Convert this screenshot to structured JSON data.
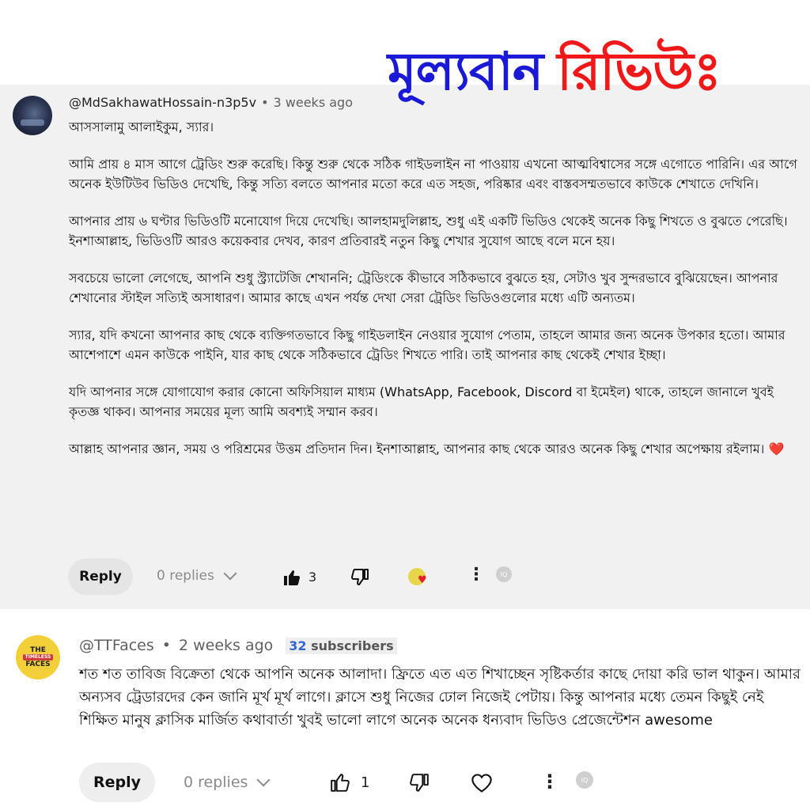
{
  "banner": {
    "word1": "মূল্যবান",
    "word2": "রিভিউঃ"
  },
  "comment1": {
    "author": "@MdSakhawatHossain-n3p5v",
    "time": "3 weeks ago",
    "paragraphs": [
      "আসসালামু আলাইকুম, স্যার।",
      "আমি প্রায় ৪ মাস আগে ট্রেডিং শুরু করেছি। কিন্তু শুরু থেকে সঠিক গাইডলাইন না পাওয়ায় এখনো আত্মবিশ্বাসের সঙ্গে এগোতে পারিনি। এর আগে অনেক ইউটিউব ভিডিও দেখেছি, কিন্তু সত্যি বলতে আপনার মতো করে এত সহজ, পরিষ্কার এবং বাস্তবসম্মতভাবে কাউকে শেখাতে দেখিনি।",
      "আপনার প্রায় ৬ ঘণ্টার ভিডিওটি মনোযোগ দিয়ে দেখেছি। আলহামদুলিল্লাহ, শুধু এই একটি ভিডিও থেকেই অনেক কিছু শিখতে ও বুঝতে পেরেছি। ইনশাআল্লাহ, ভিডিওটি আরও কয়েকবার দেখব, কারণ প্রতিবারই নতুন কিছু শেখার সুযোগ আছে বলে মনে হয়।",
      "সবচেয়ে ভালো লেগেছে, আপনি শুধু স্ট্র্যাটেজি শেখাননি; ট্রেডিংকে কীভাবে সঠিকভাবে বুঝতে হয়, সেটাও খুব সুন্দরভাবে বুঝিয়েছেন। আপনার শেখানোর স্টাইল সত্যিই অসাধারণ। আমার কাছে এখন পর্যন্ত দেখা সেরা ট্রেডিং ভিডিওগুলোর মধ্যে এটি অন্যতম।",
      "স্যার, যদি কখনো আপনার কাছ থেকে ব্যক্তিগতভাবে কিছু গাইডলাইন নেওয়ার সুযোগ পেতাম, তাহলে আমার জন্য অনেক উপকার হতো। আমার আশেপাশে এমন কাউকে পাইনি, যার কাছ থেকে সঠিকভাবে ট্রেডিং শিখতে পারি। তাই আপনার কাছ থেকেই শেখার ইচ্ছা।",
      "যদি আপনার সঙ্গে যোগাযোগ করার কোনো অফিসিয়াল মাধ্যম (WhatsApp, Facebook, Discord বা ইমেইল) থাকে, তাহলে জানালে খুবই কৃতজ্ঞ থাকব। আপনার সময়ের মূল্য আমি অবশ্যই সম্মান করব।",
      "আল্লাহ আপনার জ্ঞান, সময় ও পরিশ্রমের উত্তম প্রতিদান দিন। ইনশাআল্লাহ, আপনার কাছ থেকে আরও অনেক কিছু শেখার অপেক্ষায় রইলাম।"
    ],
    "heart": "❤️",
    "reply_label": "Reply",
    "replies_label": "0 replies",
    "likes": "3"
  },
  "comment2": {
    "author": "@TTFaces",
    "time": "2 weeks ago",
    "subscribers_count": "32",
    "subscribers_label": "subscribers",
    "avatar_top": "THE",
    "avatar_mid": "TIMELESS",
    "avatar_bottom": "FACES",
    "text": "শত শত তাবিজ বিক্রেতা থেকে আপনি অনেক আলাদা। ফ্রিতে এত এত শিখাচ্ছেন সৃষ্টিকর্তার কাছে দোয়া করি ভাল থাকুন। আমার অন্যসব ট্রেডারদের কেন জানি মূর্খ মূর্খ লাগে। ক্লাসে শুধু নিজের ঢোল নিজেই পেটায়। কিন্তু আপনার মধ্যে তেমন কিছুই নেই শিক্ষিত মানুষ ক্লাসিক মার্জিত কথাবার্তা খুবই ভালো লাগে অনেক অনেক ধন্যবাদ ভিডিও প্রেজেন্টেশন awesome",
    "reply_label": "Reply",
    "replies_label": "0 replies",
    "likes": "1"
  },
  "icons": [
    "like-icon",
    "dislike-icon",
    "creator-heart-icon",
    "more-icon",
    "translate-badge-icon",
    "heart-icon",
    "chevron-down-icon"
  ]
}
